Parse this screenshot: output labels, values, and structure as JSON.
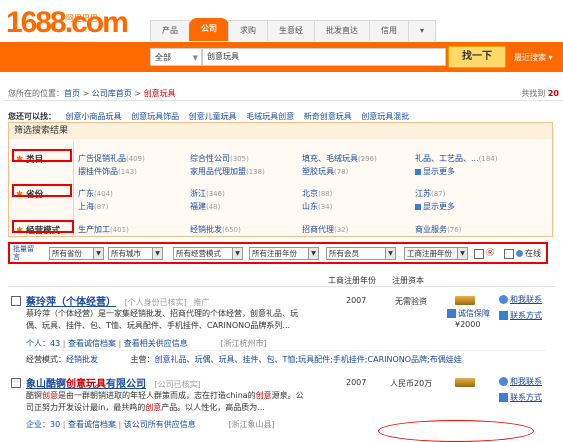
{
  "header": {
    "logo": "1688.com",
    "logo_sub": "阿里巴巴",
    "tabs": [
      "产品",
      "公司",
      "求购",
      "生意经",
      "批发直达",
      "信用",
      "▾"
    ],
    "active_tab": 1,
    "search_scope": "全部",
    "search_value": "创意玩具",
    "search_button": "找一下",
    "secondary_link": "最近搜索 ▾"
  },
  "breadcrumb": {
    "prefix": "您所在的位置：",
    "items": [
      "首页",
      "公司库首页",
      "创意玩具"
    ],
    "total_prefix": "共找到",
    "total_value": "20"
  },
  "also_search": {
    "label": "您还可以找：",
    "links": [
      "创意小商品玩具",
      "创意玩具饰品",
      "创意儿童玩具",
      "毛绒玩具创意",
      "新奇创意玩具",
      "创意玩具混批"
    ]
  },
  "filter": {
    "title": "筛选搜索结果",
    "category": {
      "label": "类目",
      "items": [
        {
          "name": "广告促销礼品",
          "count": "(409)"
        },
        {
          "name": "综合性公司",
          "count": "(305)"
        },
        {
          "name": "填充、毛绒玩具",
          "count": "(296)"
        },
        {
          "name": "礼品、工艺品、...",
          "count": "(184)"
        },
        {
          "name": "摆挂件饰品",
          "count": "(143)"
        },
        {
          "name": "家用品代理加盟",
          "count": "(138)"
        },
        {
          "name": "塑胶玩具",
          "count": "(78)"
        }
      ],
      "more": "显示更多"
    },
    "province": {
      "label": "省份",
      "items": [
        {
          "name": "广东",
          "count": "(404)"
        },
        {
          "name": "浙江",
          "count": "(346)"
        },
        {
          "name": "北京",
          "count": "(88)"
        },
        {
          "name": "江苏",
          "count": "(87)"
        },
        {
          "name": "上海",
          "count": "(87)"
        },
        {
          "name": "福建",
          "count": "(48)"
        },
        {
          "name": "山东",
          "count": "(34)"
        }
      ],
      "more": "显示更多"
    },
    "mode": {
      "label": "经营模式",
      "items": [
        {
          "name": "生产加工",
          "count": "(401)"
        },
        {
          "name": "经销批发",
          "count": "(650)"
        },
        {
          "name": "招商代理",
          "count": "(32)"
        },
        {
          "name": "商业服务",
          "count": "(76)"
        }
      ]
    }
  },
  "filter_bar": {
    "label": "批量留言",
    "dropdowns": [
      "所有省份",
      "所有城市",
      "所有经营模式",
      "所有注册年份",
      "所有会员"
    ],
    "select_label": "工商注册年份",
    "cb_icon_label": "Ⓡ",
    "online_label": "在线"
  },
  "columns": {
    "year": "工商注册年份",
    "capital": "注册资本"
  },
  "results": [
    {
      "title_pre": "",
      "title_main": "蔡玲萍（个体经营）",
      "title_hl": "",
      "tag": "[个人身份已核实]",
      "tag2": "推广",
      "year": "2007",
      "capital": "无需验资",
      "contact": "和我联系",
      "cert": "诚信保障",
      "deposit": "¥2000",
      "contact_mode": "联系方式",
      "desc_parts": [
        "蔡玲萍（个体经营）是一家集经销批发、招商代理的个体经营，创意礼品、玩",
        "偶、玩具、挂件、包、T恤、玩具配件、手机挂件、CARINONO品牌系列..."
      ],
      "age": "个人：43",
      "links": [
        "查看诚信档案",
        "查看相关供应信息"
      ],
      "loc": "[浙江杭州市]",
      "mode_label": "经营模式：",
      "mode_value": "经销批发",
      "main_label": "主营：",
      "main_value": "创意礼品、玩偶、玩具、挂件、包、T恤;玩具配件;手机挂件;CARINONO品牌;布偶娃娃"
    },
    {
      "title_pre": "象山酷锕",
      "title_hl": "创意玩具",
      "title_main": "有限公司",
      "tag": "[公司已核实]",
      "year": "2007",
      "capital": "人民币20万",
      "contact": "和我联系",
      "cert": "联系方式",
      "desc_pre": "酷锕",
      "desc_hl": "创意",
      "desc_mid": "是由一群朝销进取的年轻人群策而成，志在打造china的",
      "desc_hl2": "创意",
      "desc_end": "源泉。公",
      "desc_line2_pre": "司正努力开发设计最in，最共鸣的",
      "desc_line2_hl": "创意",
      "desc_line2_end": "产品。以人性化，高品质为...",
      "age": "企业：30",
      "links": [
        "查看诚信档案",
        "该公司所有供应信息"
      ],
      "loc": "[浙江象山县]"
    }
  ]
}
